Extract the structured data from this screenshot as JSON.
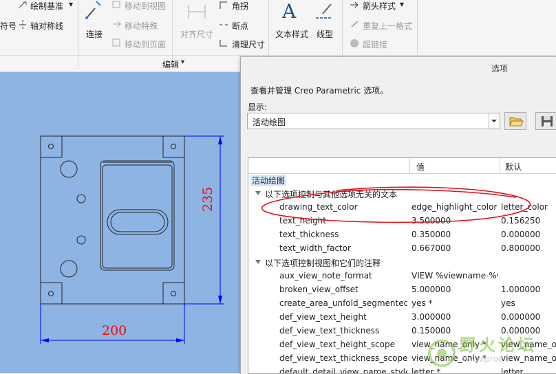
{
  "ribbon": {
    "draw_datum": "绘制基准",
    "symbol": "符号",
    "axis_of_symmetry": "轴对称线",
    "connect": "连接",
    "move_to_view": "移动到视图",
    "move_special": "移动特殊",
    "move_to_page": "移动到页面",
    "align_dims": "对齐尺寸",
    "corner": "角拐",
    "breakpoint": "断点",
    "clean_dims": "清理尺寸",
    "text_style": "文本样式",
    "line_style": "线型",
    "arrow_style": "箭头样式",
    "repeat_format": "重复上一格式",
    "hyperlink": "超链接",
    "edit_group": "编辑"
  },
  "drawing": {
    "dim_width": "200",
    "dim_height": "235"
  },
  "dialog": {
    "title": "选项",
    "description": "查看并管理 Creo Parametric 选项。",
    "show_label": "显示:",
    "show_value": "活动绘图",
    "columns": {
      "value": "值",
      "default": "默认"
    },
    "root": "活动绘图",
    "groups": [
      {
        "label": "以下选项控制与其他选项无关的文本",
        "rows": [
          {
            "name": "drawing_text_color",
            "value": "edge_highlight_color",
            "default": "letter_color"
          },
          {
            "name": "text_height",
            "value": "3.500000",
            "default": "0.156250"
          },
          {
            "name": "text_thickness",
            "value": "0.350000",
            "default": "0.000000"
          },
          {
            "name": "text_width_factor",
            "value": "0.667000",
            "default": "0.800000"
          }
        ]
      },
      {
        "label": "以下选项控制视图和它们的注释",
        "rows": [
          {
            "name": "aux_view_note_format",
            "value": "VIEW %viewname-%vi",
            "default": ""
          },
          {
            "name": "broken_view_offset",
            "value": "5.000000",
            "default": "1.000000"
          },
          {
            "name": "create_area_unfold_segmented",
            "value": "yes *",
            "default": "yes"
          },
          {
            "name": "def_view_text_height",
            "value": "3.000000",
            "default": "0.000000"
          },
          {
            "name": "def_view_text_thickness",
            "value": "0.150000",
            "default": "0.000000"
          },
          {
            "name": "def_view_text_height_scope",
            "value": "view_name_only *",
            "default": "view_name_o"
          },
          {
            "name": "def_view_text_thickness_scope",
            "value": "view_name_only *",
            "default": "view_name_o"
          },
          {
            "name": "default_detail_view_name_style",
            "value": "letter *",
            "default": "letter"
          }
        ]
      }
    ]
  },
  "watermark": {
    "text": "野火论坛",
    "url_fragment": "www.proe"
  },
  "colors": {
    "canvas": "#8eb4e3",
    "dim_line": "#0000ff",
    "dim_text": "#ff0000",
    "annotation": "#e0141e"
  }
}
